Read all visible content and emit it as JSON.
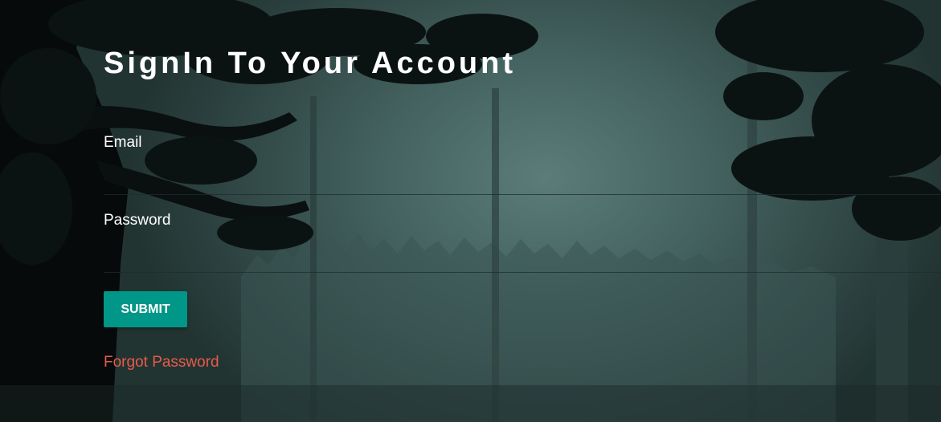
{
  "page": {
    "title": "SignIn To Your Account"
  },
  "form": {
    "email_label": "Email",
    "email_value": "",
    "password_label": "Password",
    "password_value": "",
    "submit_label": "SUBMIT",
    "forgot_label": "Forgot Password"
  },
  "colors": {
    "accent": "#009688",
    "link": "#e85a4a",
    "text": "#ffffff"
  },
  "background": {
    "description_icon": "forest-background"
  }
}
